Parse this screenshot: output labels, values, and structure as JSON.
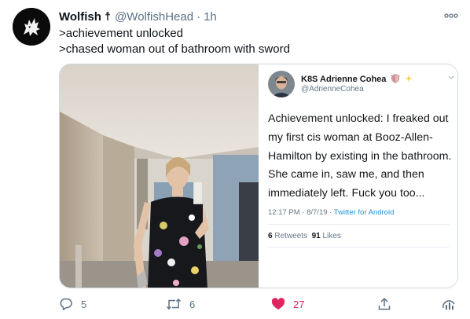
{
  "tweet": {
    "author_name": "Wolfish",
    "author_cross": "☨",
    "handle": "@WolfishHead",
    "separator": "·",
    "time": "1h",
    "lines": [
      ">achievement unlocked",
      ">chased woman out of bathroom with sword"
    ]
  },
  "quoted_screenshot": {
    "name": "K8S Adrienne Cohea",
    "handle": "@AdrienneCohea",
    "body_lines": [
      "Achievement unlocked: I freaked out",
      "my first cis woman at Booz-Allen-",
      "Hamilton by existing in the bathroom.",
      "She came in, saw me, and then",
      "immediately left. Fuck you too..."
    ],
    "timestamp": "12:17 PM · 8/7/19 · ",
    "via": "Twitter for Android",
    "retweets_count": "6",
    "retweets_label": "Retweets",
    "likes_count": "91",
    "likes_label": "Likes"
  },
  "actions": {
    "reply_count": "5",
    "retweet_count": "6",
    "like_count": "27"
  },
  "icons": {
    "more": "more-dots-icon",
    "reply": "reply-icon",
    "retweet": "retweet-icon",
    "like": "heart-filled-icon",
    "share": "share-icon",
    "analytics": "analytics-icon",
    "verified_badges": "shield-badge-icon"
  },
  "colors": {
    "text": "#0f1419",
    "secondary": "#5b7083",
    "like": "#e0245e",
    "link": "#1b95e0",
    "border": "#cfd9de"
  }
}
